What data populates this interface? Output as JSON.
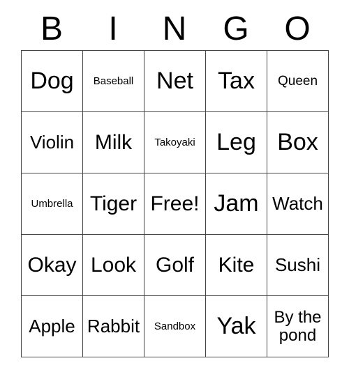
{
  "card": {
    "headers": [
      "B",
      "I",
      "N",
      "G",
      "O"
    ],
    "rows": [
      [
        {
          "text": "Dog",
          "size": "sz-xl"
        },
        {
          "text": "Baseball",
          "size": "sz-xs"
        },
        {
          "text": "Net",
          "size": "sz-xl"
        },
        {
          "text": "Tax",
          "size": "sz-xl"
        },
        {
          "text": "Queen",
          "size": "sz-sm"
        }
      ],
      [
        {
          "text": "Violin",
          "size": "sz-md"
        },
        {
          "text": "Milk",
          "size": "sz-lg"
        },
        {
          "text": "Takoyaki",
          "size": "sz-xs"
        },
        {
          "text": "Leg",
          "size": "sz-xl"
        },
        {
          "text": "Box",
          "size": "sz-xl"
        }
      ],
      [
        {
          "text": "Umbrella",
          "size": "sz-xs"
        },
        {
          "text": "Tiger",
          "size": "sz-lg"
        },
        {
          "text": "Free!",
          "size": "sz-lg"
        },
        {
          "text": "Jam",
          "size": "sz-xl"
        },
        {
          "text": "Watch",
          "size": "sz-md"
        }
      ],
      [
        {
          "text": "Okay",
          "size": "sz-lg"
        },
        {
          "text": "Look",
          "size": "sz-lg"
        },
        {
          "text": "Golf",
          "size": "sz-lg"
        },
        {
          "text": "Kite",
          "size": "sz-lg"
        },
        {
          "text": "Sushi",
          "size": "sz-md"
        }
      ],
      [
        {
          "text": "Apple",
          "size": "sz-md"
        },
        {
          "text": "Rabbit",
          "size": "sz-md"
        },
        {
          "text": "Sandbox",
          "size": "sz-xs"
        },
        {
          "text": "Yak",
          "size": "sz-xl"
        },
        {
          "text": "By the\npond",
          "size": "sz-two"
        }
      ]
    ],
    "free_space": "Free!",
    "colors": {
      "background": "#ffffff",
      "border": "#444444",
      "text": "#000000"
    }
  }
}
